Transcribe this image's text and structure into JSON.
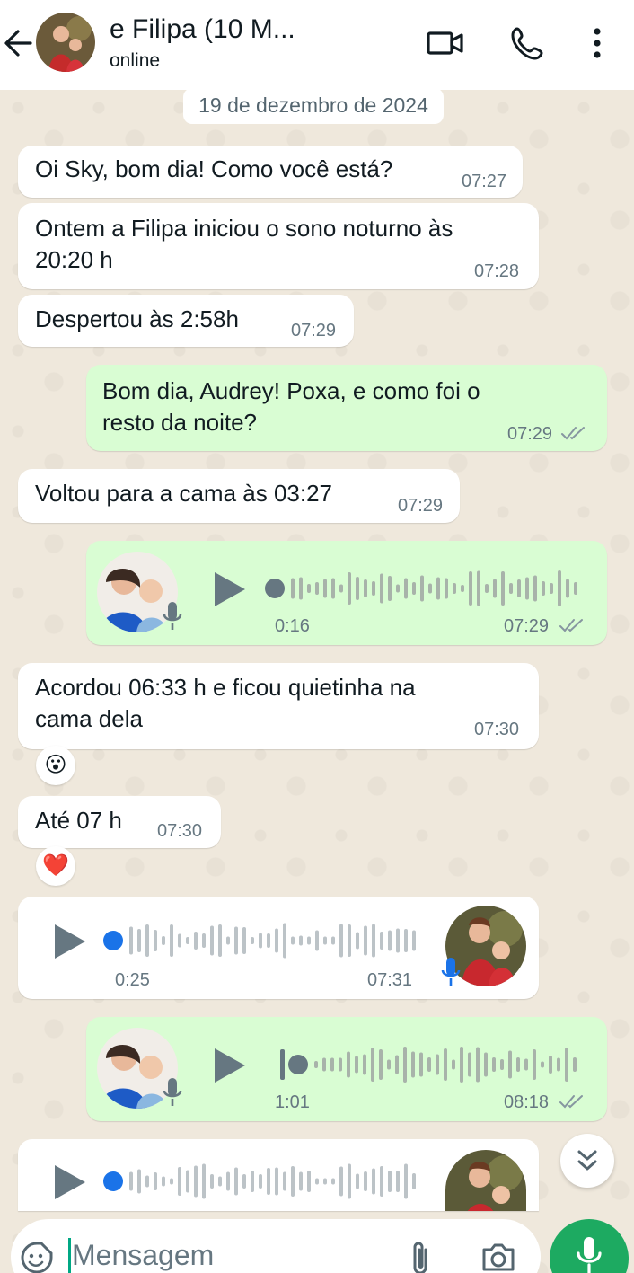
{
  "header": {
    "title": " e Filipa (10 M...",
    "status": "online",
    "back_icon": "arrow-left-icon",
    "video_icon": "video-call-icon",
    "call_icon": "phone-icon",
    "menu_icon": "more-vertical-icon"
  },
  "date_chip": "19 de dezembro de 2024",
  "messages": [
    {
      "lines": [
        "Oi Sky, bom dia! Como você está?"
      ],
      "time": "07:27"
    },
    {
      "lines": [
        "Ontem a Filipa iniciou o sono noturno às",
        "20:20 h"
      ],
      "time": "07:28"
    },
    {
      "lines": [
        "Despertou às 2:58h"
      ],
      "time": "07:29"
    },
    {
      "lines": [
        "Bom dia, Audrey! Poxa, e como foi o",
        "resto da noite?"
      ],
      "time": "07:29",
      "status": "read"
    },
    {
      "lines": [
        "Voltou para a cama às 03:27"
      ],
      "time": "07:29"
    },
    {
      "voice": true,
      "duration": "0:16",
      "time": "07:29",
      "status": "read"
    },
    {
      "lines": [
        "Acordou 06:33 h e ficou quietinha na",
        "cama dela"
      ],
      "time": "07:30",
      "reaction": "😮"
    },
    {
      "lines": [
        "Até 07 h"
      ],
      "time": "07:30",
      "reaction": "❤️"
    },
    {
      "voice": true,
      "duration": "0:25",
      "time": "07:31"
    },
    {
      "voice": true,
      "duration": "1:01",
      "time": "08:18",
      "status": "read"
    },
    {
      "voice": true
    }
  ],
  "input": {
    "placeholder": "Mensagem",
    "sticker_icon": "sticker-icon",
    "attach_icon": "paperclip-icon",
    "camera_icon": "camera-icon",
    "mic_icon": "microphone-icon"
  },
  "scroll_icon": "double-chevron-down-icon",
  "colors": {
    "outgoing": "#d9fdd3",
    "incoming": "#ffffff",
    "accent": "#1daa61",
    "read_ticks": "#8696a0",
    "voice_dot": "#1a73e8"
  }
}
